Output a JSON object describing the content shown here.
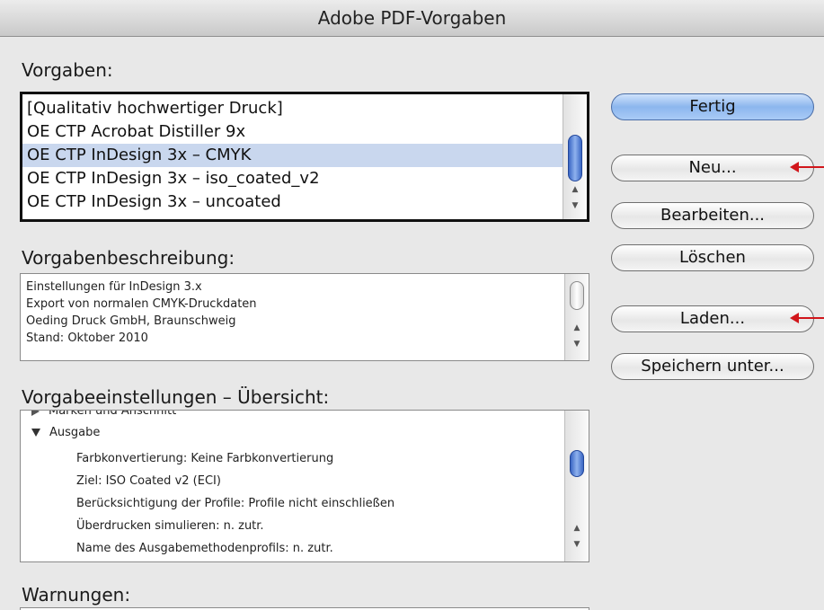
{
  "window": {
    "title": "Adobe PDF-Vorgaben"
  },
  "presets": {
    "label": "Vorgaben:",
    "items": [
      "[Qualitativ hochwertiger Druck]",
      "OE CTP Acrobat Distiller 9x",
      "OE CTP InDesign 3x – CMYK",
      "OE CTP InDesign 3x – iso_coated_v2",
      "OE CTP InDesign 3x – uncoated"
    ],
    "selected_index": 2
  },
  "description": {
    "label": "Vorgabenbeschreibung:",
    "lines": [
      "Einstellungen für InDesign 3.x",
      "Export von normalen CMYK-Druckdaten",
      "Oeding Druck GmbH, Braunschweig",
      "Stand: Oktober 2010"
    ]
  },
  "summary": {
    "label": "Vorgabeeinstellungen – Übersicht:",
    "rows": [
      "Marken und Anschnitt",
      "Ausgabe",
      "Farbkonvertierung: Keine Farbkonvertierung",
      "Ziel: ISO Coated v2 (ECI)",
      "Berücksichtigung der Profile: Profile nicht einschließen",
      "Überdrucken simulieren: n. zutr.",
      "Name des Ausgabemethodenprofils: n. zutr."
    ]
  },
  "warnings": {
    "label": "Warnungen:"
  },
  "buttons": {
    "done": "Fertig",
    "new": "Neu...",
    "edit": "Bearbeiten...",
    "delete": "Löschen",
    "load": "Laden...",
    "save_as": "Speichern unter..."
  },
  "colors": {
    "selection": "#c9d7ee",
    "annotation_arrow": "#d1161b",
    "default_button": "#8cb6ee"
  }
}
